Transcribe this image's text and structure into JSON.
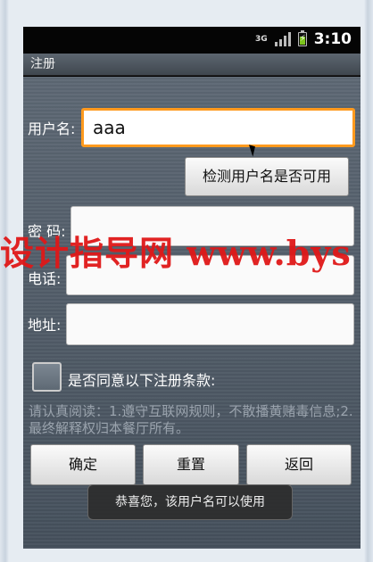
{
  "statusbar": {
    "network_label": "3G",
    "time": "3:10"
  },
  "app": {
    "title": "注册"
  },
  "form": {
    "username_label": "用户名:",
    "username_value": "aaa",
    "check_button": "检测用户名是否可用",
    "password_label": "密 码:",
    "password_value": "",
    "phone_label": "电话:",
    "phone_value": "",
    "address_label": "地址:",
    "address_value": "",
    "agree_label": "是否同意以下注册条款:",
    "terms_text": "请认真阅读：1.遵守互联网规则，不散播黄赌毒信息;2.最终解释权归本餐厅所有。",
    "confirm_button": "确定",
    "reset_button": "重置",
    "back_button": "返回"
  },
  "toast": {
    "message": "恭喜您，该用户名可以使用"
  },
  "watermark": {
    "text": "设计指导网 www.bys"
  },
  "colors": {
    "focus": "#ff9a1e",
    "watermark": "#e01818"
  }
}
